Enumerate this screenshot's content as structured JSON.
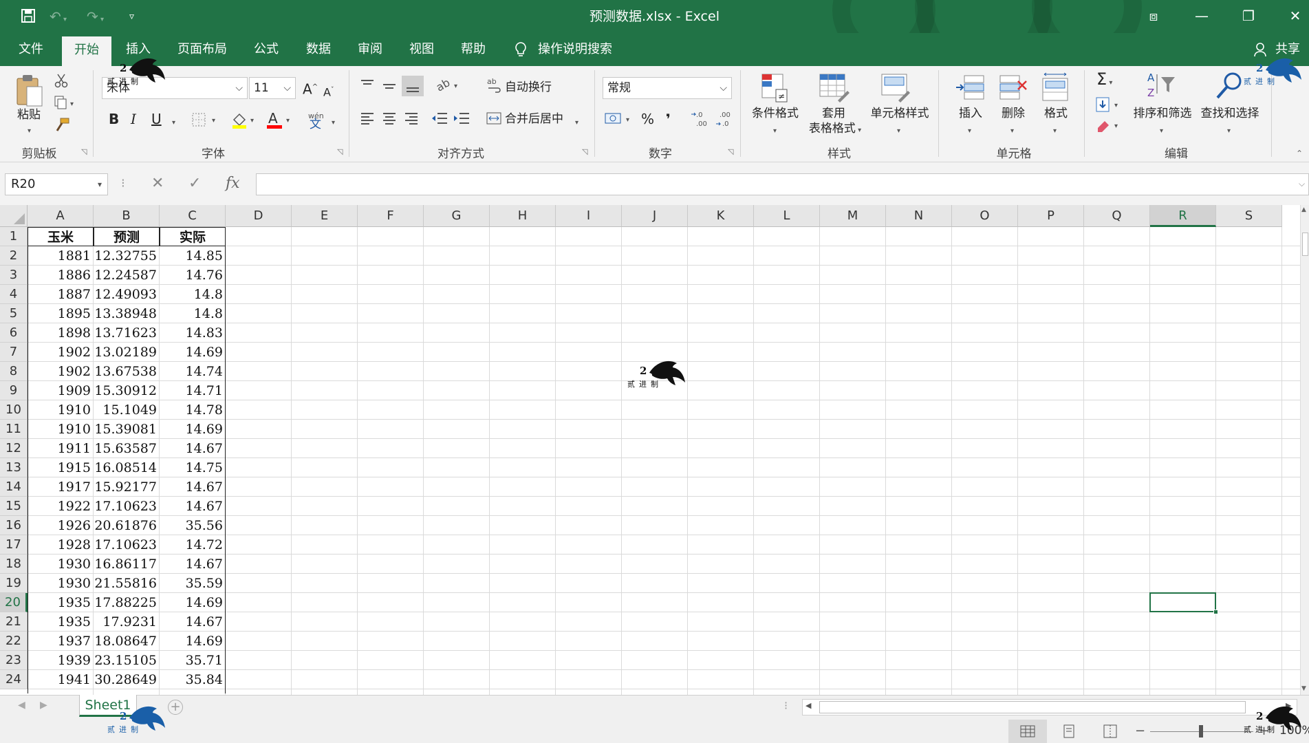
{
  "window": {
    "title": "预测数据.xlsx  -  Excel",
    "controls": {
      "ribbon_display": "⧈",
      "minimize": "—",
      "restore": "❐",
      "close": "✕"
    }
  },
  "quick_access": {
    "save": "save-icon",
    "undo": "undo-icon",
    "redo": "redo-icon",
    "customize": "customize-icon"
  },
  "tabs": [
    "文件",
    "开始",
    "插入",
    "页面布局",
    "公式",
    "数据",
    "审阅",
    "视图",
    "帮助"
  ],
  "active_tab": "开始",
  "tell_me": "操作说明搜索",
  "share": "共享",
  "ribbon": {
    "clipboard": {
      "label": "剪贴板",
      "paste": "粘贴"
    },
    "font": {
      "label": "字体",
      "font_name": "宋体",
      "font_size": "11",
      "bold": "B",
      "italic": "I",
      "underline": "U",
      "grow": "A",
      "shrink": "A",
      "phonetic_top": "wén",
      "phonetic_bottom": "文"
    },
    "alignment": {
      "label": "对齐方式",
      "wrap_text": "自动换行",
      "merge_center": "合并后居中"
    },
    "number": {
      "label": "数字",
      "format": "常规",
      "percent": "%",
      "comma": "❜",
      "inc_decimal": ".00",
      "dec_decimal": ".0"
    },
    "styles": {
      "label": "样式",
      "conditional": "条件格式",
      "table_format_1": "套用",
      "table_format_2": "表格格式",
      "cell_styles": "单元格样式"
    },
    "cells": {
      "label": "单元格",
      "insert": "插入",
      "delete": "删除",
      "format": "格式"
    },
    "editing": {
      "label": "编辑",
      "autosum": "Σ",
      "sort_filter": "排序和筛选",
      "find_select": "查找和选择"
    }
  },
  "formula_bar": {
    "name_box": "R20",
    "cancel": "✕",
    "enter": "✓",
    "fx": "fx",
    "content": ""
  },
  "grid": {
    "columns": [
      "A",
      "B",
      "C",
      "D",
      "E",
      "F",
      "G",
      "H",
      "I",
      "J",
      "K",
      "L",
      "M",
      "N",
      "O",
      "P",
      "Q",
      "R",
      "S"
    ],
    "selected_column": "R",
    "selected_row": "20",
    "rows": [
      "1",
      "2",
      "3",
      "4",
      "5",
      "6",
      "7",
      "8",
      "9",
      "10",
      "11",
      "12",
      "13",
      "14",
      "15",
      "16",
      "17",
      "18",
      "19",
      "20",
      "21",
      "22",
      "23",
      "24"
    ],
    "headers": [
      "玉米",
      "预测",
      "实际"
    ],
    "data": [
      [
        "1881",
        "12.32755",
        "14.85"
      ],
      [
        "1886",
        "12.24587",
        "14.76"
      ],
      [
        "1887",
        "12.49093",
        "14.8"
      ],
      [
        "1895",
        "13.38948",
        "14.8"
      ],
      [
        "1898",
        "13.71623",
        "14.83"
      ],
      [
        "1902",
        "13.02189",
        "14.69"
      ],
      [
        "1902",
        "13.67538",
        "14.74"
      ],
      [
        "1909",
        "15.30912",
        "14.71"
      ],
      [
        "1910",
        "15.1049",
        "14.78"
      ],
      [
        "1910",
        "15.39081",
        "14.69"
      ],
      [
        "1911",
        "15.63587",
        "14.67"
      ],
      [
        "1915",
        "16.08514",
        "14.75"
      ],
      [
        "1917",
        "15.92177",
        "14.67"
      ],
      [
        "1922",
        "17.10623",
        "14.67"
      ],
      [
        "1926",
        "20.61876",
        "35.56"
      ],
      [
        "1928",
        "17.10623",
        "14.72"
      ],
      [
        "1930",
        "16.86117",
        "14.67"
      ],
      [
        "1930",
        "21.55816",
        "35.59"
      ],
      [
        "1935",
        "17.88225",
        "14.69"
      ],
      [
        "1935",
        "17.9231",
        "14.67"
      ],
      [
        "1937",
        "18.08647",
        "14.69"
      ],
      [
        "1939",
        "23.15105",
        "35.71"
      ],
      [
        "1941",
        "30.28649",
        "35.84"
      ]
    ]
  },
  "sheets": {
    "active": "Sheet1",
    "add": "+"
  },
  "status": {
    "zoom": "100%",
    "views": [
      "normal-view-icon",
      "page-layout-icon",
      "page-break-icon"
    ]
  },
  "watermark": {
    "number": "2",
    "text": "贰进制"
  },
  "colors": {
    "accent": "#217346",
    "ribbon_bg": "#f3f3f3",
    "grid_line": "#dadada"
  }
}
